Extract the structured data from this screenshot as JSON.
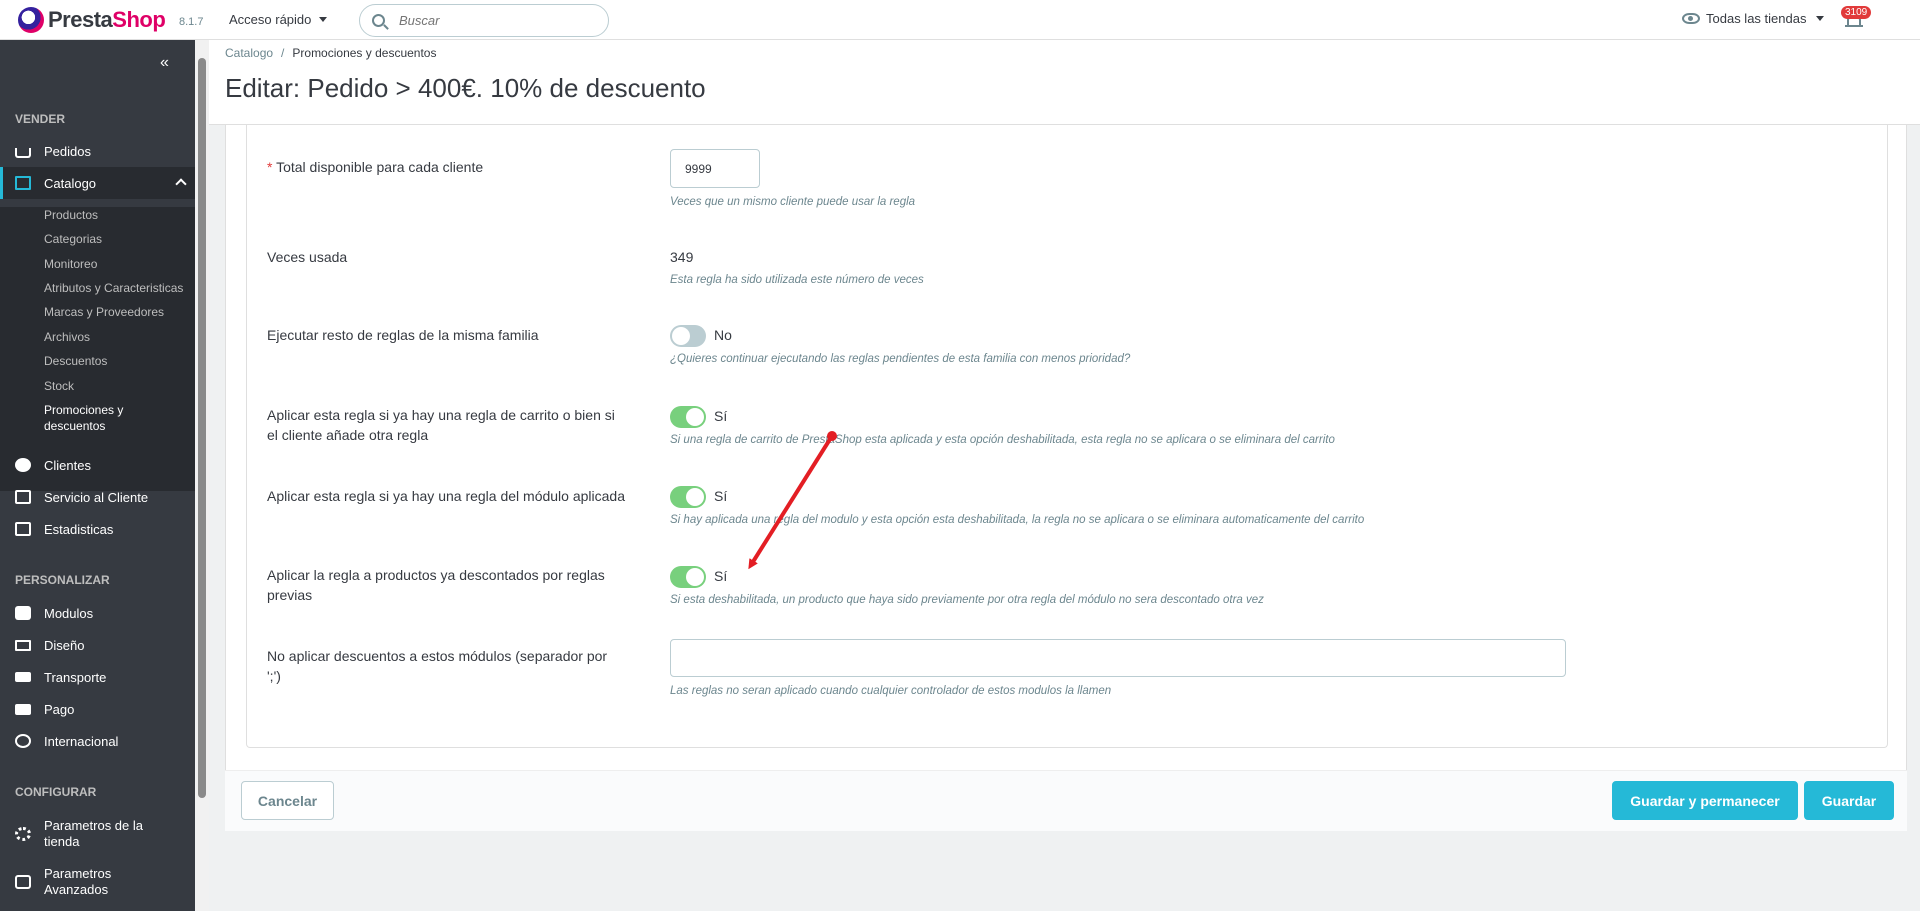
{
  "header": {
    "logo_text_a": "Presta",
    "logo_text_b": "Shop",
    "version": "8.1.7",
    "quick_access": "Acceso rápido",
    "search_placeholder": "Buscar",
    "stores": "Todas las tiendas",
    "notifications_count": "3109"
  },
  "sidebar": {
    "section_sell": "VENDER",
    "section_customize": "PERSONALIZAR",
    "section_configure": "CONFIGURAR",
    "orders": "Pedidos",
    "catalog": "Catalogo",
    "catalog_sub": [
      "Productos",
      "Categorias",
      "Monitoreo",
      "Atributos y Caracteristicas",
      "Marcas y Proveedores",
      "Archivos",
      "Descuentos",
      "Stock"
    ],
    "promotions_line1": "Promociones y",
    "promotions_line2": "descuentos",
    "customers": "Clientes",
    "customer_service": "Servicio al Cliente",
    "stats": "Estadisticas",
    "modules": "Modulos",
    "design": "Diseño",
    "shipping": "Transporte",
    "payment": "Pago",
    "international": "Internacional",
    "shop_params_line1": "Parametros de la",
    "shop_params_line2": "tienda",
    "advanced_line1": "Parametros",
    "advanced_line2": "Avanzados"
  },
  "breadcrumb": {
    "root": "Catalogo",
    "sep": "/",
    "current": "Promociones y descuentos"
  },
  "page_title": "Editar: Pedido > 400€. 10% de descuento",
  "form": {
    "total_per_customer": {
      "label": "Total disponible para cada cliente",
      "value": "9999",
      "help": "Veces que un mismo cliente puede usar la regla"
    },
    "times_used": {
      "label": "Veces usada",
      "value": "349",
      "help": "Esta regla ha sido utilizada este número de veces"
    },
    "run_rest": {
      "label": "Ejecutar resto de reglas de la misma familia",
      "state": "No",
      "help": "¿Quieres continuar ejecutando las reglas pendientes de esta familia con menos prioridad?"
    },
    "apply_cart_rule": {
      "label_line1": "Aplicar esta regla si ya hay una regla de carrito o bien si",
      "label_line2": "el cliente añade otra regla",
      "state": "Sí",
      "help": "Si una regla de carrito de PrestaShop esta aplicada y esta opción deshabilitada, esta regla no se aplicara o se eliminara del carrito"
    },
    "apply_module_rule": {
      "label": "Aplicar esta regla si ya hay una regla del módulo aplicada",
      "state": "Sí",
      "help": "Si hay aplicada una regla del modulo y esta opción esta deshabilitada, la regla no se aplicara o se eliminara automaticamente del carrito"
    },
    "apply_discounted": {
      "label_line1": "Aplicar la regla a productos ya descontados por reglas",
      "label_line2": "previas",
      "state": "Sí",
      "help": "Si esta deshabilitada, un producto que haya sido previamente por otra regla del módulo no sera descontado otra vez"
    },
    "exclude_modules": {
      "label_line1": "No aplicar descuentos a estos módulos (separador por",
      "label_line2": "';')",
      "value": "",
      "help": "Las reglas no seran aplicado cuando cualquier controlador de estos modulos la llamen"
    }
  },
  "footer": {
    "cancel": "Cancelar",
    "save_stay": "Guardar y permanecer",
    "save": "Guardar"
  },
  "colors": {
    "accent": "#25b9d7",
    "toggle_on": "#78d07d",
    "sidebar": "#363a41",
    "arrow": "#e31e24"
  }
}
